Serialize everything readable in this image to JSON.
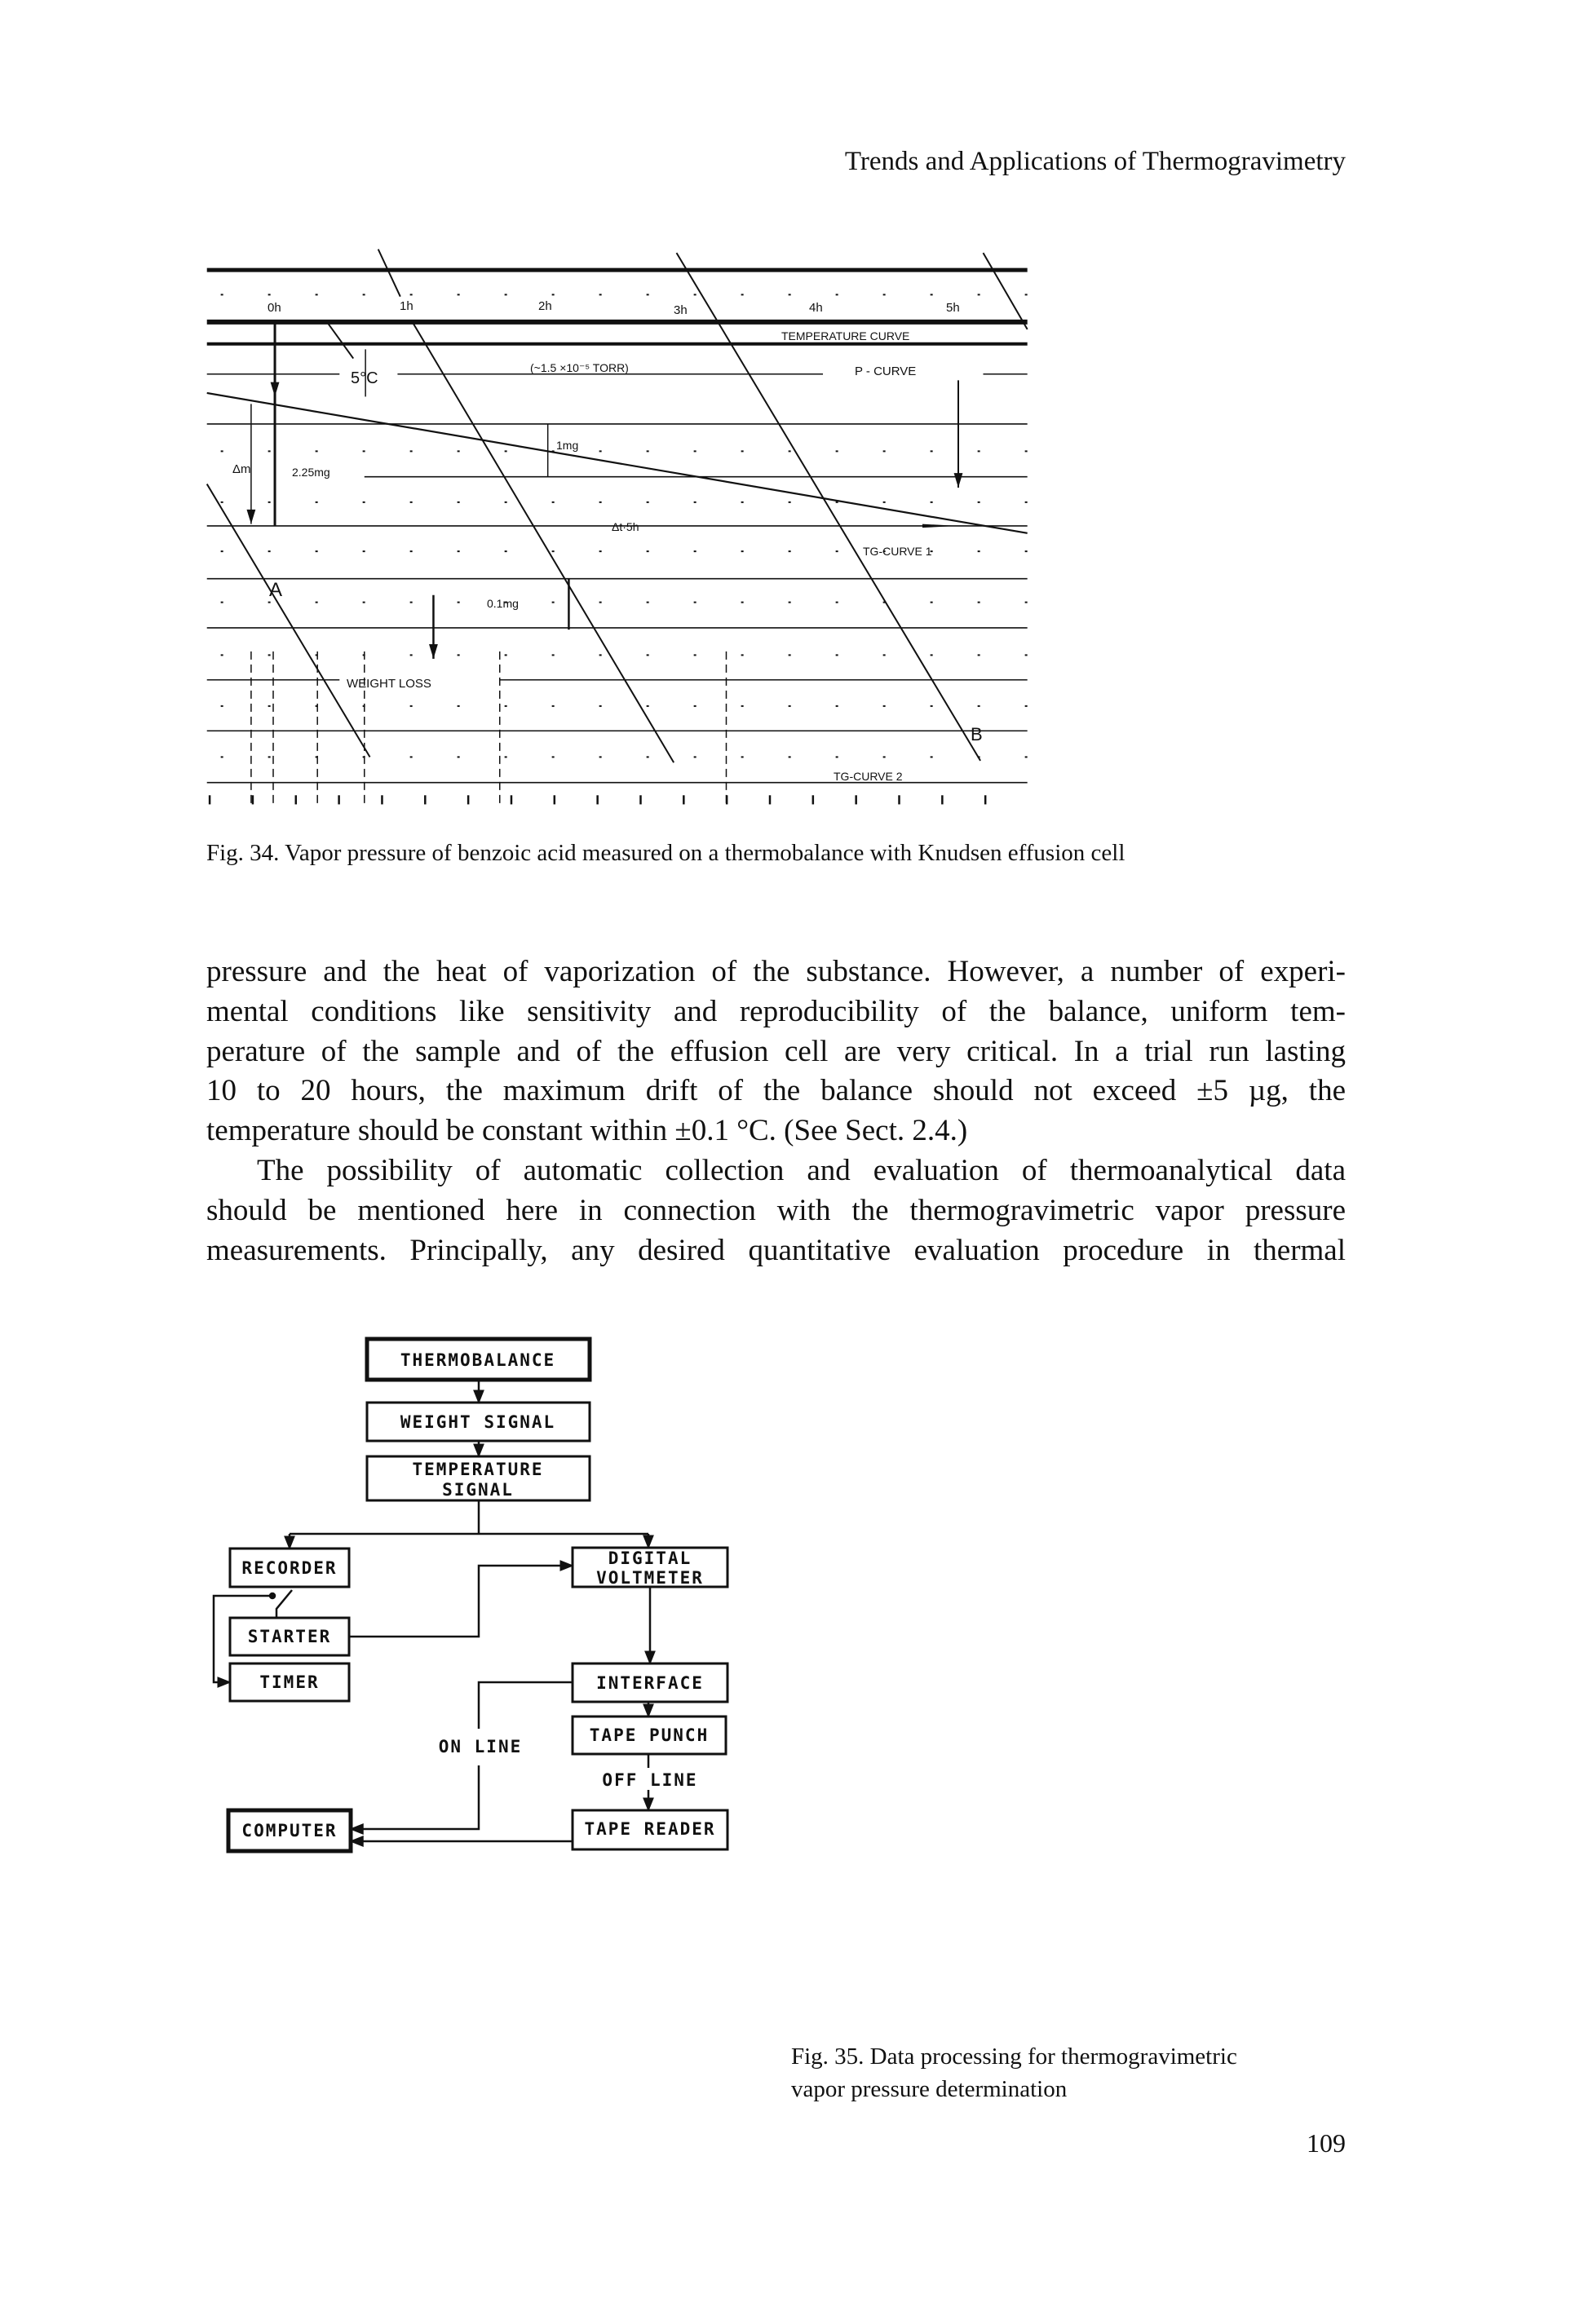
{
  "header": {
    "running_title": "Trends and Applications of Thermogravimetry"
  },
  "figure34": {
    "labels": {
      "h0": "0h",
      "h1": "1h",
      "h2": "2h",
      "h3": "3h",
      "h4": "4h",
      "h5": "5h",
      "temperature_curve": "TEMPERATURE CURVE",
      "five_c": "5°C",
      "torr": "(~1.5 ×10⁻⁵ TORR)",
      "p_curve": "P - CURVE",
      "one_mg": "1mg",
      "delta_m": "Δm",
      "mass": "2.25mg",
      "delta_t": "Δt·5h",
      "tg_curve_1": "TG-CURVE 1",
      "point_a": "A",
      "tenth_mg": "0.1mg",
      "weight_loss": "WEIGHT LOSS",
      "point_b": "B",
      "tg_curve_2": "TG-CURVE 2"
    },
    "caption": "Fig. 34. Vapor pressure of benzoic acid measured on a thermobalance with Knudsen effusion cell"
  },
  "body": {
    "paragraph1": [
      "pressure and the heat of vaporization of the substance. However, a number of experi-",
      "mental conditions like sensitivity and reproducibility of the balance, uniform tem-",
      "perature of the sample and of the effusion cell are very critical. In a trial run lasting",
      "10 to 20 hours, the maximum drift of the balance should not exceed ±5 µg, the",
      "temperature should be constant within ±0.1 °C. (See Sect. 2.4.)"
    ],
    "paragraph2": [
      "The possibility of automatic collection and evaluation of thermoanalytical data",
      "should be mentioned here in connection with the thermogravimetric vapor pressure",
      "measurements. Principally, any desired quantitative evaluation procedure in thermal"
    ]
  },
  "figure35": {
    "boxes": {
      "thermobalance": "THERMOBALANCE",
      "weight_signal": "WEIGHT SIGNAL",
      "temperature_signal_1": "TEMPERATURE",
      "temperature_signal_2": "SIGNAL",
      "recorder": "RECORDER",
      "digital_voltmeter_1": "DIGITAL",
      "digital_voltmeter_2": "VOLTMETER",
      "starter": "STARTER",
      "timer": "TIMER",
      "interface": "INTERFACE",
      "tape_punch": "TAPE PUNCH",
      "tape_reader": "TAPE READER",
      "computer": "COMPUTER"
    },
    "on_line": "ON LINE",
    "off_line": "OFF LINE",
    "caption_lines": [
      "Fig. 35. Data processing for thermogravimetric",
      "vapor pressure determination"
    ]
  },
  "page_number": "109"
}
